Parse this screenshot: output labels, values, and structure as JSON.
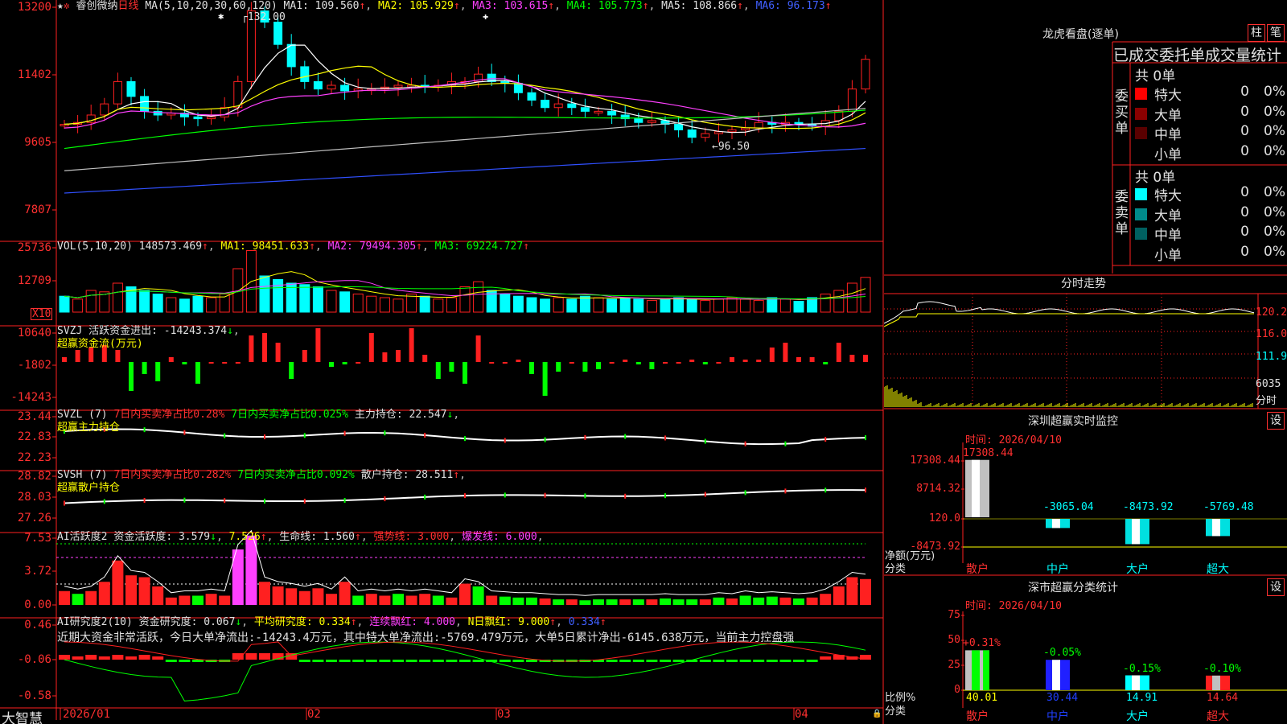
{
  "app": {
    "brand": "大智慧",
    "stock_name": "睿创微纳",
    "period": "日线"
  },
  "main": {
    "ma_header": {
      "label": "MA(5,10,20,30,60,120)",
      "ma1": "MA1: 109.560",
      "ma2": "MA2: 105.929",
      "ma3": "MA3: 103.615",
      "ma4": "MA4: 105.773",
      "ma5": "MA5: 108.866",
      "ma6": "MA6: 96.173"
    },
    "y_labels": [
      "13200",
      "11402",
      "9605",
      "7807"
    ],
    "high_marker": "132.00",
    "low_marker": "←96.50"
  },
  "vol": {
    "header": "VOL(5,10,20)",
    "value": "148573.469",
    "ma1": "MA1: 98451.633",
    "ma2": "MA2: 79494.305",
    "ma3": "MA3: 69224.727",
    "y_labels": [
      "25736",
      "12709"
    ],
    "unit": "X10"
  },
  "svzj": {
    "header": "SVZJ  活跃资金进出: -14243.374",
    "subtitle": "超赢资金流(万元)",
    "y_labels": [
      "10640",
      "-1802",
      "-14243"
    ]
  },
  "svzl": {
    "label": "SVZL (7)",
    "t1": "7日内买卖净占比0.28%",
    "t2": "7日内买卖净占比0.025%",
    "t3": "主力持仓: 22.547",
    "subtitle": "超赢主力持仓",
    "y_labels": [
      "23.44",
      "22.83",
      "22.23"
    ]
  },
  "svsh": {
    "label": "SVSH (7)",
    "t1": "7日内买卖净占比0.282%",
    "t2": "7日内买卖净占比0.092%",
    "t3": "散户持仓: 28.511",
    "subtitle": "超赢散户持仓",
    "y_labels": [
      "28.82",
      "28.03",
      "27.26"
    ]
  },
  "ai1": {
    "label": "AI活跃度2",
    "t1": "资金活跃度: 3.579",
    "t2": "7.526",
    "t3": "生命线: 1.560",
    "t4": "强势线: 3.000",
    "t5": "爆发线: 6.000",
    "y_labels": [
      "7.53",
      "3.72",
      "0.00"
    ]
  },
  "ai2": {
    "label": "AI研究度2(10)",
    "t1": "资金研究度: 0.067",
    "t2": "平均研究度: 0.334",
    "t3": "连续飘红: 4.000",
    "t4": "N日飘红: 9.000",
    "t5": "0.334",
    "summary": "近期大资金非常活跃，今日大单净流出:-14243.4万元，其中特大单净流出:-5769.479万元，大单5日累计净出-6145.638万元，当前主力控盘强",
    "y_labels": [
      "0.46",
      "-0.06",
      "-0.58"
    ]
  },
  "x_labels": [
    "2026/01",
    "02",
    "03",
    "04"
  ],
  "panel1": {
    "title": "龙虎看盘(逐单)",
    "btn1": "柱",
    "btn2": "笔",
    "subtitle": "已成交委托单成交量统计",
    "buy": {
      "label": "委买单",
      "total": "共 0单",
      "rows": [
        {
          "name": "特大",
          "v": "0",
          "p": "0%",
          "color": "#ff0000"
        },
        {
          "name": "大单",
          "v": "0",
          "p": "0%",
          "color": "#8b0000"
        },
        {
          "name": "中单",
          "v": "0",
          "p": "0%",
          "color": "#5a0000"
        },
        {
          "name": "小单",
          "v": "0",
          "p": "0%",
          "color": "#000000"
        }
      ]
    },
    "sell": {
      "label": "委卖单",
      "total": "共 0单",
      "rows": [
        {
          "name": "特大",
          "v": "0",
          "p": "0%",
          "color": "#00ffff"
        },
        {
          "name": "大单",
          "v": "0",
          "p": "0%",
          "color": "#008b8b"
        },
        {
          "name": "中单",
          "v": "0",
          "p": "0%",
          "color": "#006060"
        },
        {
          "name": "小单",
          "v": "0",
          "p": "0%",
          "color": "#000000"
        }
      ]
    }
  },
  "panel2": {
    "title": "分时走势",
    "y_labels": [
      "120.2",
      "116.0",
      "111.9",
      "6035"
    ],
    "unit": "分时"
  },
  "panel3": {
    "title": "深圳超赢实时监控",
    "btn": "设",
    "time": "时间: 2026/04/10",
    "y_labels": [
      "17308.44",
      "8714.32",
      "120.0",
      "-8473.92"
    ],
    "ylabel": "净额(万元)",
    "xlabel": "分类",
    "chart_data": {
      "type": "bar",
      "categories": [
        "散户",
        "中户",
        "大户",
        "超大"
      ],
      "values": [
        17308.44,
        -3065.04,
        -8473.92,
        -5769.48
      ],
      "value_labels": [
        "17308.44",
        "-3065.04",
        "-8473.92",
        "-5769.48"
      ]
    }
  },
  "panel4": {
    "title": "深市超赢分类统计",
    "btn": "设",
    "time": "时间: 2026/04/10",
    "y_labels": [
      "75",
      "50",
      "25",
      "0"
    ],
    "ylabel": "比例%",
    "xlabel": "分类",
    "chart_data": {
      "type": "bar",
      "categories": [
        "散户",
        "中户",
        "大户",
        "超大"
      ],
      "values": [
        40.01,
        30.44,
        14.91,
        14.64
      ],
      "changes": [
        "+0.31%",
        "-0.05%",
        "-0.15%",
        "-0.10%"
      ],
      "value_labels": [
        "40.01",
        "30.44",
        "14.91",
        "14.64"
      ],
      "ylim": [
        0,
        75
      ]
    }
  }
}
